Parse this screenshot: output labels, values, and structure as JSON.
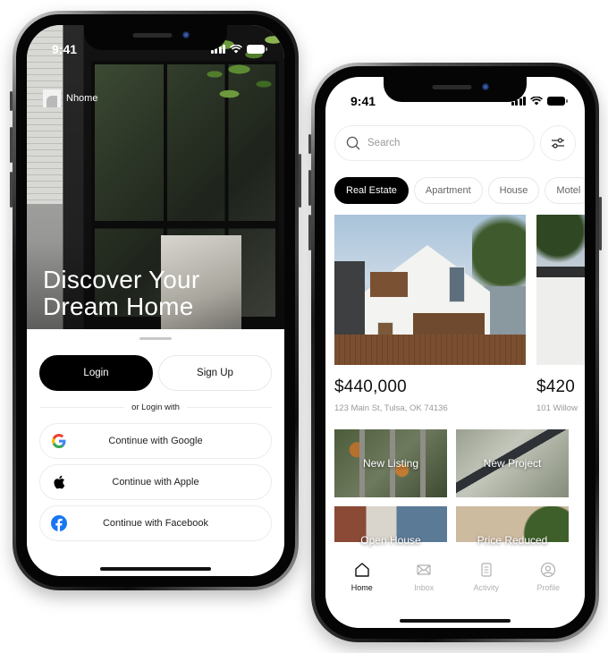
{
  "login_screen": {
    "status_bar": {
      "time": "9:41"
    },
    "brand": {
      "name": "Nhome",
      "logo_icon": "house-logo-icon"
    },
    "hero": {
      "title_line1": "Discover Your",
      "title_line2": "Dream Home"
    },
    "auth": {
      "login_label": "Login",
      "signup_label": "Sign Up"
    },
    "divider_text": "or Login with",
    "social_buttons": [
      {
        "label": "Continue with Google",
        "icon": "google-icon"
      },
      {
        "label": "Continue with Apple",
        "icon": "apple-icon"
      },
      {
        "label": "Continue with Facebook",
        "icon": "facebook-icon"
      }
    ]
  },
  "home_screen": {
    "status_bar": {
      "time": "9:41"
    },
    "search": {
      "placeholder": "Search",
      "icon": "search-icon",
      "filter_icon": "sliders-icon"
    },
    "categories": [
      {
        "label": "Real Estate",
        "active": true
      },
      {
        "label": "Apartment",
        "active": false
      },
      {
        "label": "House",
        "active": false
      },
      {
        "label": "Motel",
        "active": false
      }
    ],
    "listings": [
      {
        "price": "$440,000",
        "address": "123 Main St, Tulsa, OK 74136"
      },
      {
        "price": "$420",
        "address": "101 Willow"
      }
    ],
    "tiles": [
      {
        "label": "New Listing"
      },
      {
        "label": "New Project"
      },
      {
        "label": "Open House"
      },
      {
        "label": "Price Reduced"
      }
    ],
    "tabbar": [
      {
        "label": "Home",
        "icon": "home-icon",
        "active": true
      },
      {
        "label": "Inbox",
        "icon": "mail-icon",
        "active": false
      },
      {
        "label": "Activity",
        "icon": "clipboard-list-icon",
        "active": false
      },
      {
        "label": "Profile",
        "icon": "user-circle-icon",
        "active": false
      }
    ]
  },
  "colors": {
    "primary": "#000000",
    "background": "#ffffff",
    "border": "#ececec",
    "muted_text": "#9a9a9a",
    "facebook_blue": "#1877f2"
  }
}
